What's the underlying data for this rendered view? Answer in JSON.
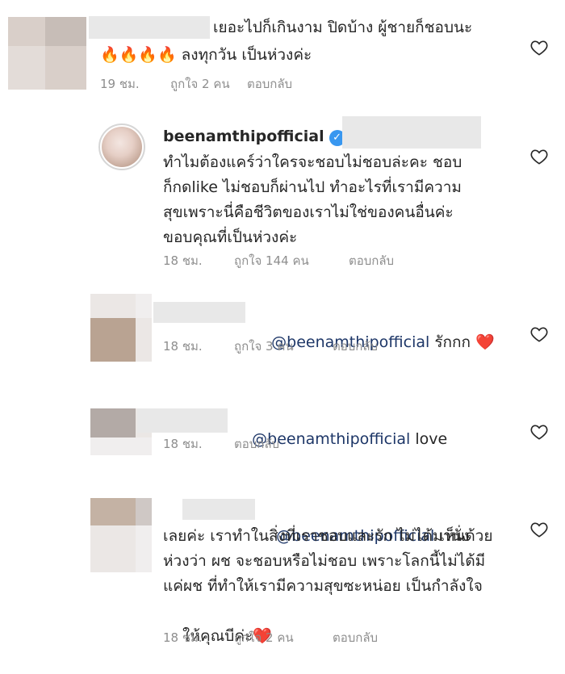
{
  "comments": [
    {
      "line1": "เยอะไปก็เกินงาม ปิดบ้าง ผู้ชายก็ชอบนะ",
      "line2": "🔥🔥🔥🔥 ลงทุกวัน เป็นห่วงค่ะ",
      "time": "19 ชม.",
      "likes": "ถูกใจ 2 คน",
      "reply": "ตอบกลับ"
    },
    {
      "username": "beenamthipofficial",
      "lines": [
        "ทำไมต้องแคร์ว่าใครจะชอบไม่ชอบล่ะคะ ชอบ",
        "ก็กดlike ไม่ชอบก็ผ่านไป ทำอะไรที่เรามีความ",
        "สุขเพราะนี่คือชีวิตของเราไม่ใช่ของคนอื่นค่ะ",
        "ขอบคุณที่เป็นห่วงค่ะ"
      ],
      "time": "18 ชม.",
      "likes": "ถูกใจ 144 คน",
      "reply": "ตอบกลับ"
    },
    {
      "mention": "@beenamthipofficial",
      "text": " รักกก ",
      "emoji": "❤️",
      "time": "18 ชม.",
      "likes": "ถูกใจ 3 คน",
      "reply": "ตอบกลับ"
    },
    {
      "mention": "@beenamthipofficial",
      "text": " love",
      "time": "18 ชม.",
      "reply": "ตอบกลับ"
    },
    {
      "mention": "@beenamthipofficial",
      "text": " เห็นด้วย",
      "lines": [
        "เลยค่ะ เราทำในสิ่งที่เราชอบและรัก ไม่ได้มานั่ง",
        "ห่วงว่า ผช จะชอบหรือไม่ชอบ เพราะโลกนี้ไม่ได้มี",
        "แค่ผช ที่ทำให้เรามีความสุขซะหน่อย เป็นกำลังใจ",
        "ให้คุณบีค่ะ"
      ],
      "emoji": "❤️",
      "time": "18 ชม.",
      "likes": "ถูกใจ 2 คน",
      "reply": "ตอบกลับ"
    }
  ]
}
